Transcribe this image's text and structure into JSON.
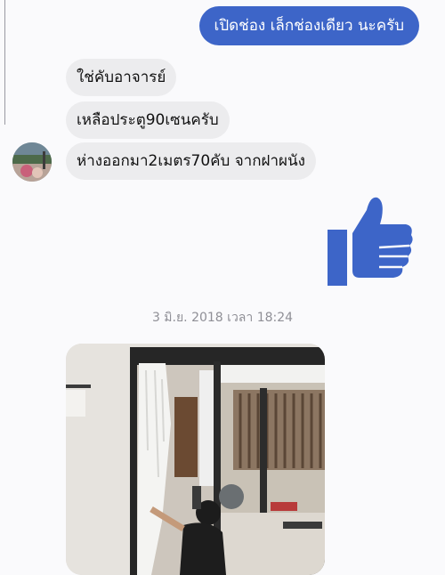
{
  "messages": {
    "sent_1": "เปิดช่อง เล็กช่องเดียว นะครับ",
    "recv_1": "ใช่คับอาจารย์",
    "recv_2": "เหลือประตู90เซนครับ",
    "recv_3": "ห่างออกมา2เมตร70คับ จากฝาผนัง"
  },
  "timestamp": "3 มิ.ย. 2018 เวลา 18:24",
  "icons": {
    "like": "thumbs-up-icon",
    "avatar": "contact-avatar"
  },
  "colors": {
    "sent_bubble": "#3d65c8",
    "received_bubble": "#ececee",
    "like_icon": "#3d65c8"
  }
}
